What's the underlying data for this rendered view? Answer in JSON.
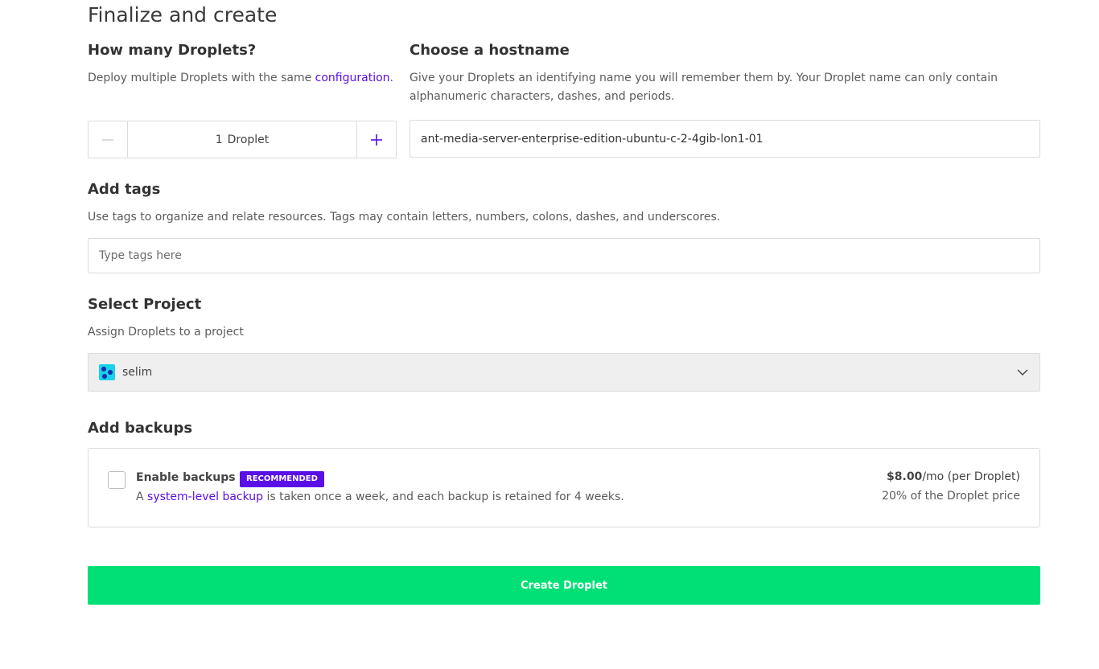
{
  "page": {
    "title": "Finalize and create"
  },
  "droplets": {
    "title": "How many Droplets?",
    "desc_prefix": "Deploy multiple Droplets with the same ",
    "desc_link": "configuration",
    "desc_suffix": ".",
    "count": "1",
    "unit": "Droplet"
  },
  "hostname": {
    "title": "Choose a hostname",
    "desc": "Give your Droplets an identifying name you will remember them by. Your Droplet name can only contain alphanumeric characters, dashes, and periods.",
    "value": "ant-media-server-enterprise-edition-ubuntu-c-2-4gib-lon1-01"
  },
  "tags": {
    "title": "Add tags",
    "desc": "Use tags to organize and relate resources. Tags may contain letters, numbers, colons, dashes, and underscores.",
    "placeholder": "Type tags here"
  },
  "project": {
    "title": "Select Project",
    "desc": "Assign Droplets to a project",
    "selected": "selim"
  },
  "backups": {
    "title": "Add backups",
    "label": "Enable backups",
    "badge": "RECOMMENDED",
    "desc_prefix": "A ",
    "desc_link": "system-level backup",
    "desc_suffix": " is taken once a week, and each backup is retained for 4 weeks.",
    "price_amount": "$8.00",
    "price_period": "/mo (per Droplet)",
    "price_note": "20% of the Droplet price"
  },
  "actions": {
    "create_label": "Create Droplet"
  },
  "colors": {
    "accent": "#5a0fe6",
    "create": "#00e076",
    "project_icon": "#16d3e8"
  }
}
